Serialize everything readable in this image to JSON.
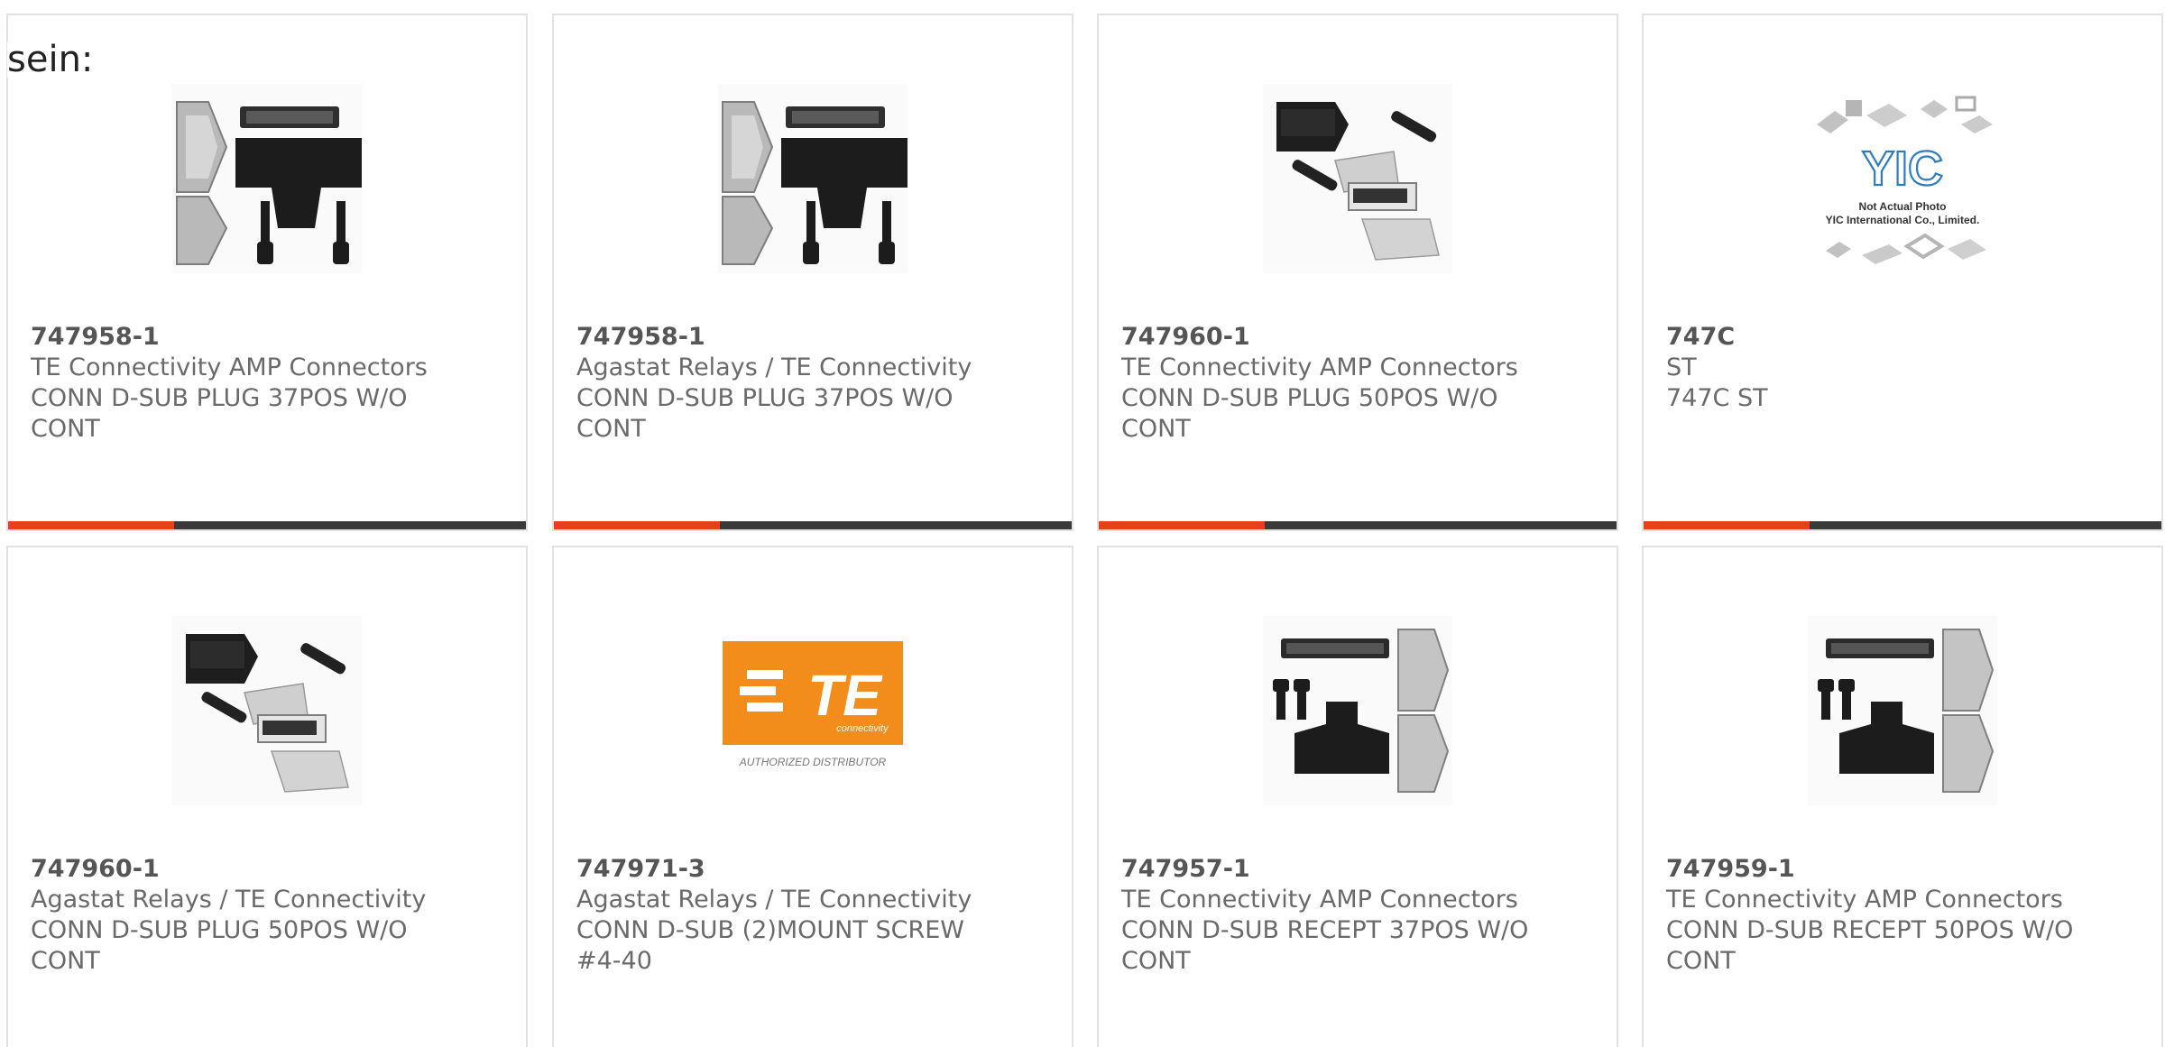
{
  "lead_text": "sein:",
  "accent_color": "#e8401c",
  "bar_color": "#3a3a3a",
  "products": [
    {
      "part_number": "747958-1",
      "line1": "TE Connectivity AMP Connectors",
      "line2": "CONN D-SUB PLUG 37POS W/O",
      "line3": "CONT",
      "image": "dsub-kit-37-icon"
    },
    {
      "part_number": "747958-1",
      "line1": "Agastat Relays / TE Connectivity",
      "line2": "CONN D-SUB PLUG 37POS W/O",
      "line3": "CONT",
      "image": "dsub-kit-37-icon"
    },
    {
      "part_number": "747960-1",
      "line1": "TE Connectivity AMP Connectors",
      "line2": "CONN D-SUB PLUG 50POS W/O",
      "line3": "CONT",
      "image": "dsub-kit-50-icon"
    },
    {
      "part_number": "747C",
      "line1": "ST",
      "line2": "747C ST",
      "line3": "",
      "image": "yic-placeholder-icon",
      "image_text": {
        "logo": "YIC",
        "line_a": "Not Actual Photo",
        "line_b": "YIC International Co., Limited."
      }
    },
    {
      "part_number": "747960-1",
      "line1": "Agastat Relays / TE Connectivity",
      "line2": "CONN D-SUB PLUG 50POS W/O",
      "line3": "CONT",
      "image": "dsub-kit-50-icon"
    },
    {
      "part_number": "747971-3",
      "line1": "Agastat Relays / TE Connectivity",
      "line2": "CONN D-SUB (2)MOUNT SCREW",
      "line3": "#4-40",
      "image": "te-logo-icon",
      "image_text": {
        "logo": "TE",
        "sub": "connectivity",
        "caption": "AUTHORIZED DISTRIBUTOR"
      }
    },
    {
      "part_number": "747957-1",
      "line1": "TE Connectivity AMP Connectors",
      "line2": "CONN D-SUB RECEPT 37POS W/O",
      "line3": "CONT",
      "image": "dsub-receptacle-kit-icon"
    },
    {
      "part_number": "747959-1",
      "line1": "TE Connectivity AMP Connectors",
      "line2": "CONN D-SUB RECEPT 50POS W/O",
      "line3": "CONT",
      "image": "dsub-receptacle-kit-icon"
    }
  ]
}
